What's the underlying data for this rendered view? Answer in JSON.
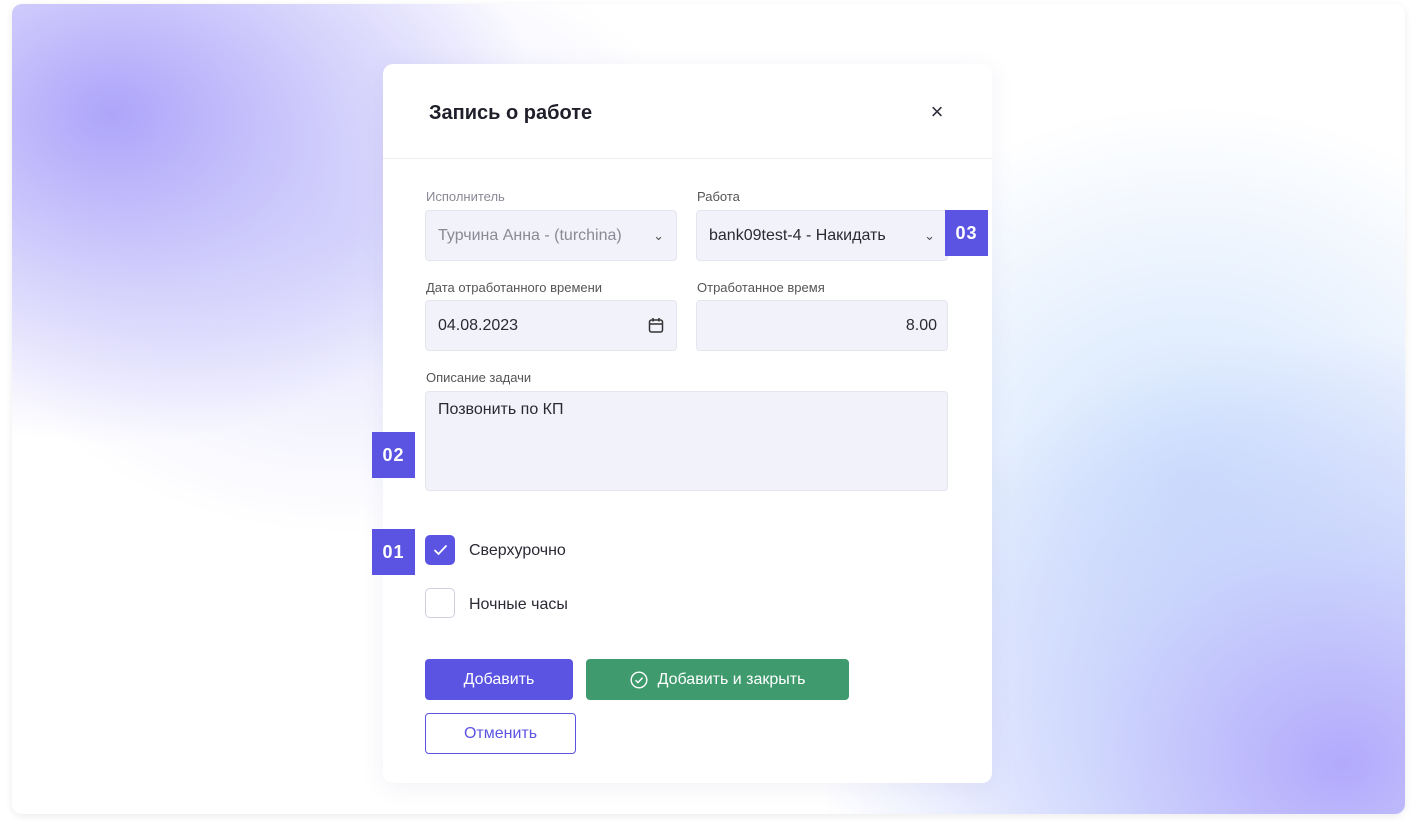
{
  "dialog": {
    "title": "Запись о работе",
    "close_icon": "×"
  },
  "form": {
    "executor": {
      "label": "Исполнитель",
      "value": "Турчина Анна - (turchina)"
    },
    "work": {
      "label": "Работа",
      "value": "bank09test-4 - Накидать"
    },
    "date": {
      "label": "Дата отработанного времени",
      "value": "04.08.2023"
    },
    "hours": {
      "label": "Отработанное время",
      "value": "8.00"
    },
    "description": {
      "label": "Описание задачи",
      "value": "Позвонить по КП"
    },
    "overtime": {
      "label": "Сверхурочно",
      "checked": true
    },
    "night_hours": {
      "label": "Ночные часы",
      "checked": false
    }
  },
  "buttons": {
    "add": "Добавить",
    "add_close": "Добавить и закрыть",
    "cancel": "Отменить"
  },
  "badges": [
    "01",
    "02",
    "03"
  ],
  "colors": {
    "accent": "#5b54e3",
    "success": "#3f9b6d"
  }
}
